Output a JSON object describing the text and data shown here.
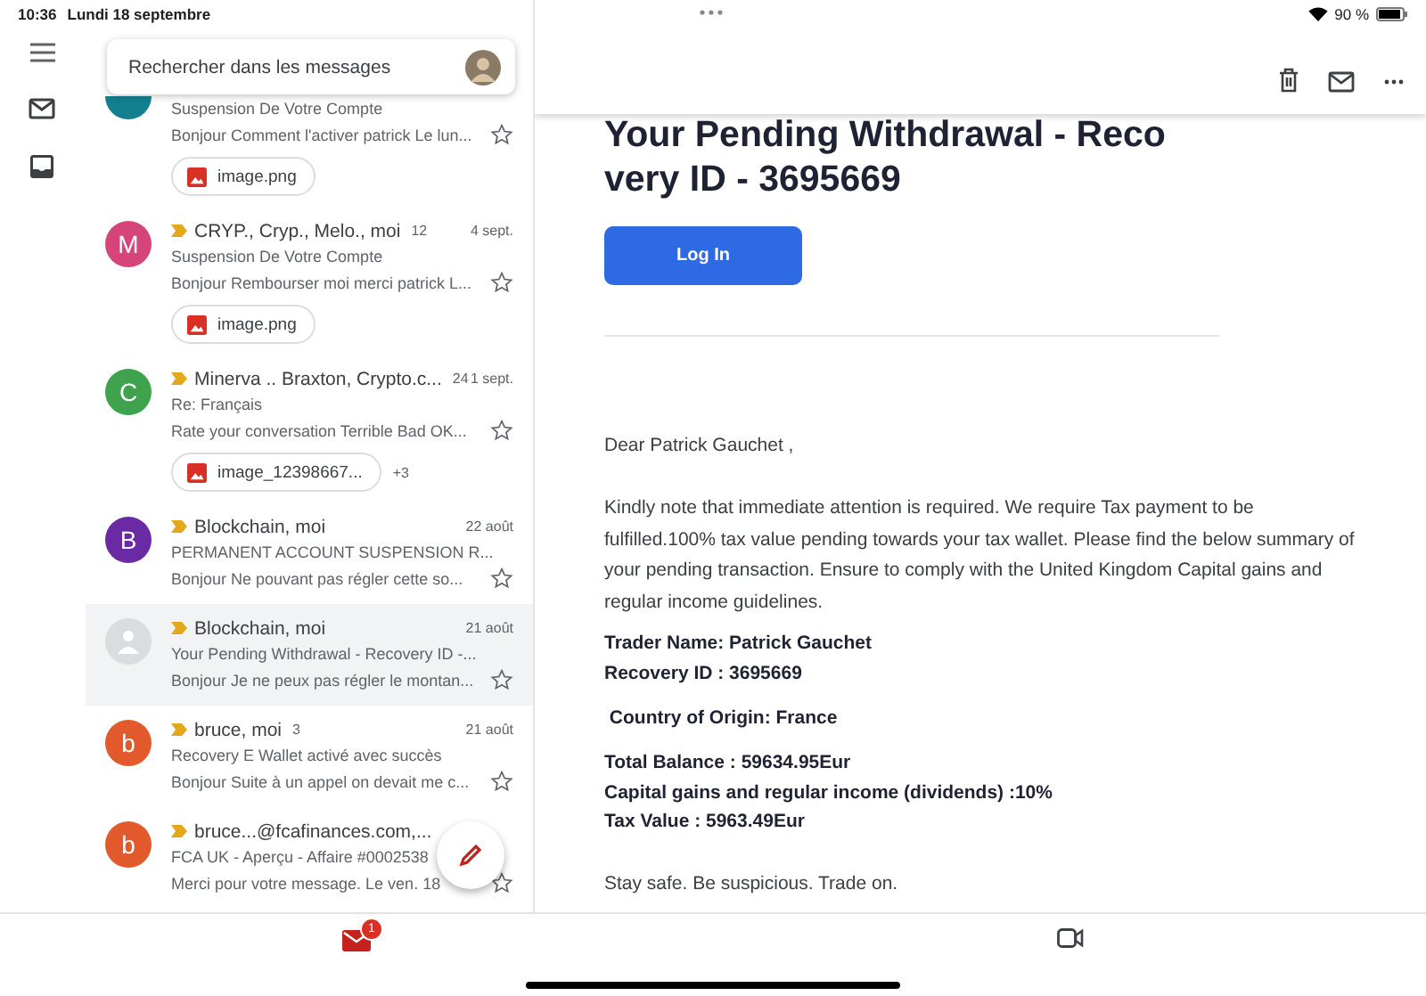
{
  "status_bar": {
    "time": "10:36",
    "date": "Lundi 18 septembre",
    "battery": "90 %"
  },
  "search": {
    "placeholder": "Rechercher dans les messages"
  },
  "messages": [
    {
      "avatar": {
        "color": "#12808f"
      },
      "subject": "Suspension De Votre Compte",
      "snippet": "Bonjour Comment l'activer patrick Le lun...",
      "attachments": [
        "image.png"
      ],
      "selected": false,
      "starred": false
    },
    {
      "avatar": {
        "letter": "M",
        "color": "#d6457a"
      },
      "important": true,
      "sender": "CRYP., Cryp., Melo., moi",
      "count": "12",
      "date": "4 sept.",
      "subject": "Suspension De Votre Compte",
      "snippet": "Bonjour Rembourser moi merci patrick L...",
      "attachments": [
        "image.png"
      ],
      "selected": false,
      "starred": false
    },
    {
      "avatar": {
        "letter": "C",
        "color": "#3fa34d"
      },
      "important": true,
      "sender": "Minerva .. Braxton, Crypto.c...",
      "count": "24",
      "date": "1 sept.",
      "subject": "Re: Français",
      "snippet": "Rate your conversation Terrible Bad OK...",
      "attachments": [
        "image_12398667..."
      ],
      "more": "+3",
      "selected": false,
      "starred": false
    },
    {
      "avatar": {
        "letter": "B",
        "color": "#6a2aa3"
      },
      "important": true,
      "sender": "Blockchain, moi",
      "date": "22 août",
      "subject": "PERMANENT ACCOUNT SUSPENSION R...",
      "snippet": "Bonjour Ne pouvant pas régler cette so...",
      "selected": false,
      "starred": false
    },
    {
      "important": true,
      "sender": "Blockchain, moi",
      "date": "21 août",
      "subject": "Your Pending Withdrawal - Recovery ID -...",
      "snippet": "Bonjour Je ne peux pas régler le montan...",
      "selected": true,
      "starred": false
    },
    {
      "avatar": {
        "letter": "b",
        "color": "#e25a2b"
      },
      "important": true,
      "sender": "bruce, moi",
      "count": "3",
      "date": "21 août",
      "subject": "Recovery E Wallet activé avec succès",
      "snippet": "Bonjour Suite à un appel on devait me c...",
      "selected": false,
      "starred": false
    },
    {
      "avatar": {
        "letter": "b",
        "color": "#e25a2b"
      },
      "important": true,
      "sender": "bruce...@fcafinances.com,...",
      "subject": "FCA UK - Aperçu - Affaire #0002538",
      "snippet": "Merci pour votre message. Le ven. 18",
      "selected": false,
      "starred": false
    }
  ],
  "email": {
    "title_lines": [
      "Your Pending Withdrawal - Reco",
      "very ID - 3695669"
    ],
    "button": "Log In",
    "greeting": "Dear Patrick Gauchet ,",
    "paragraph": "Kindly note that immediate attention is required. We require Tax payment to be fulfilled.100% tax value pending towards your tax wallet. Please find the below summary of your pending transaction. Ensure to comply with the United Kingdom Capital gains and regular income guidelines.",
    "details": [
      [
        "Trader Name: Patrick Gauchet",
        "Recovery ID : 3695669"
      ],
      [
        " Country of Origin: France"
      ],
      [
        "Total Balance : 59634.95Eur",
        "Capital gains and regular income (dividends) :10%",
        "Tax Value : 5963.49Eur"
      ]
    ],
    "closing": "Stay safe. Be suspicious. Trade on."
  },
  "bottom_bar": {
    "mail_badge": "1"
  }
}
